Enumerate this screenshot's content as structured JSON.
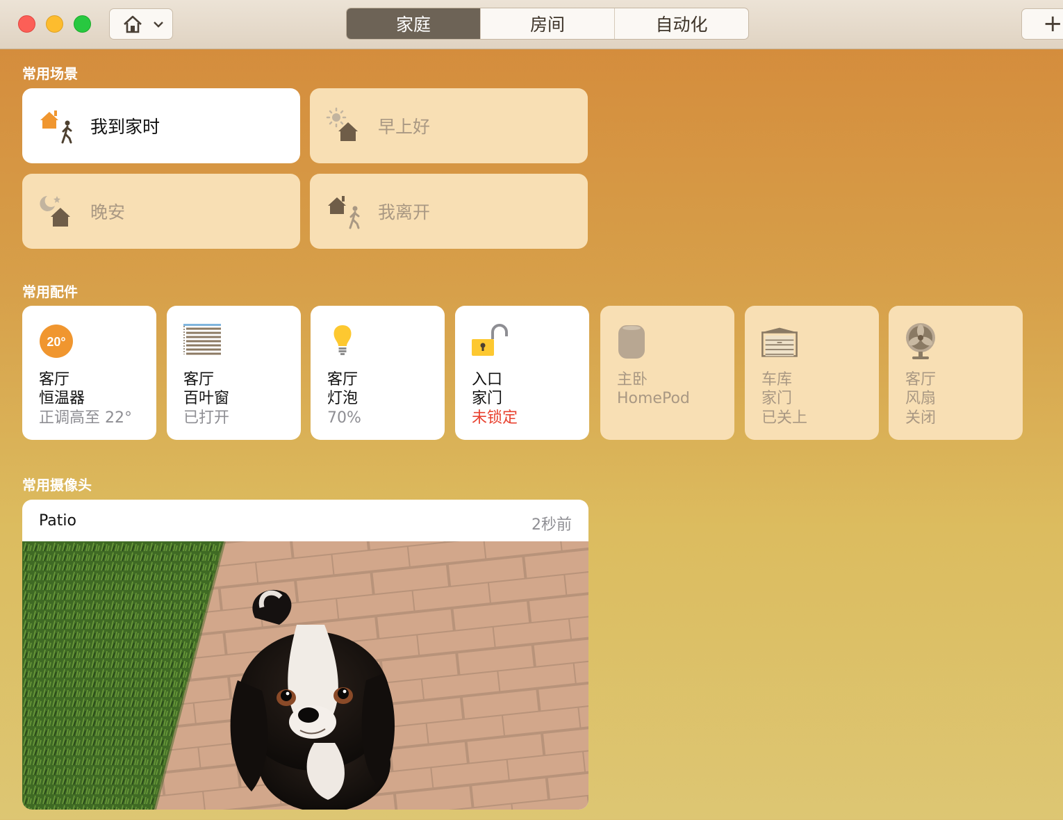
{
  "toolbar": {
    "tabs": [
      {
        "label": "家庭",
        "active": true
      },
      {
        "label": "房间",
        "active": false
      },
      {
        "label": "自动化",
        "active": false
      }
    ],
    "add_label": "+"
  },
  "sections": {
    "scenes_title": "常用场景",
    "accessories_title": "常用配件",
    "cameras_title": "常用摄像头"
  },
  "scenes": [
    {
      "label": "我到家时",
      "active": true,
      "icon": "house-arrive-icon"
    },
    {
      "label": "早上好",
      "active": false,
      "icon": "morning-house-icon"
    },
    {
      "label": "晚安",
      "active": false,
      "icon": "night-house-icon"
    },
    {
      "label": "我离开",
      "active": false,
      "icon": "house-leave-icon"
    }
  ],
  "accessories": [
    {
      "room": "客厅",
      "name": "恒温器",
      "status": "正调高至 22°",
      "active": true,
      "icon": "thermostat-icon",
      "badge": "20°"
    },
    {
      "room": "客厅",
      "name": "百叶窗",
      "status": "已打开",
      "active": true,
      "icon": "blinds-icon"
    },
    {
      "room": "客厅",
      "name": "灯泡",
      "status": "70%",
      "active": true,
      "icon": "lightbulb-icon"
    },
    {
      "room": "入口",
      "name": "家门",
      "status": "未锁定",
      "active": true,
      "icon": "unlocked-lock-icon",
      "status_color": "#e8412f"
    },
    {
      "room": "主卧",
      "name": "HomePod",
      "status": "",
      "active": false,
      "icon": "homepod-icon"
    },
    {
      "room": "车库",
      "name": "家门",
      "status": "已关上",
      "active": false,
      "icon": "garage-door-icon"
    },
    {
      "room": "客厅",
      "name": "风扇",
      "status": "关闭",
      "active": false,
      "icon": "fan-icon"
    }
  ],
  "camera": {
    "name": "Patio",
    "time": "2秒前"
  },
  "colors": {
    "accent_orange": "#f0962f",
    "tile_inactive": "#f8dfb4",
    "tile_active": "#ffffff",
    "alert_red": "#e8412f"
  }
}
